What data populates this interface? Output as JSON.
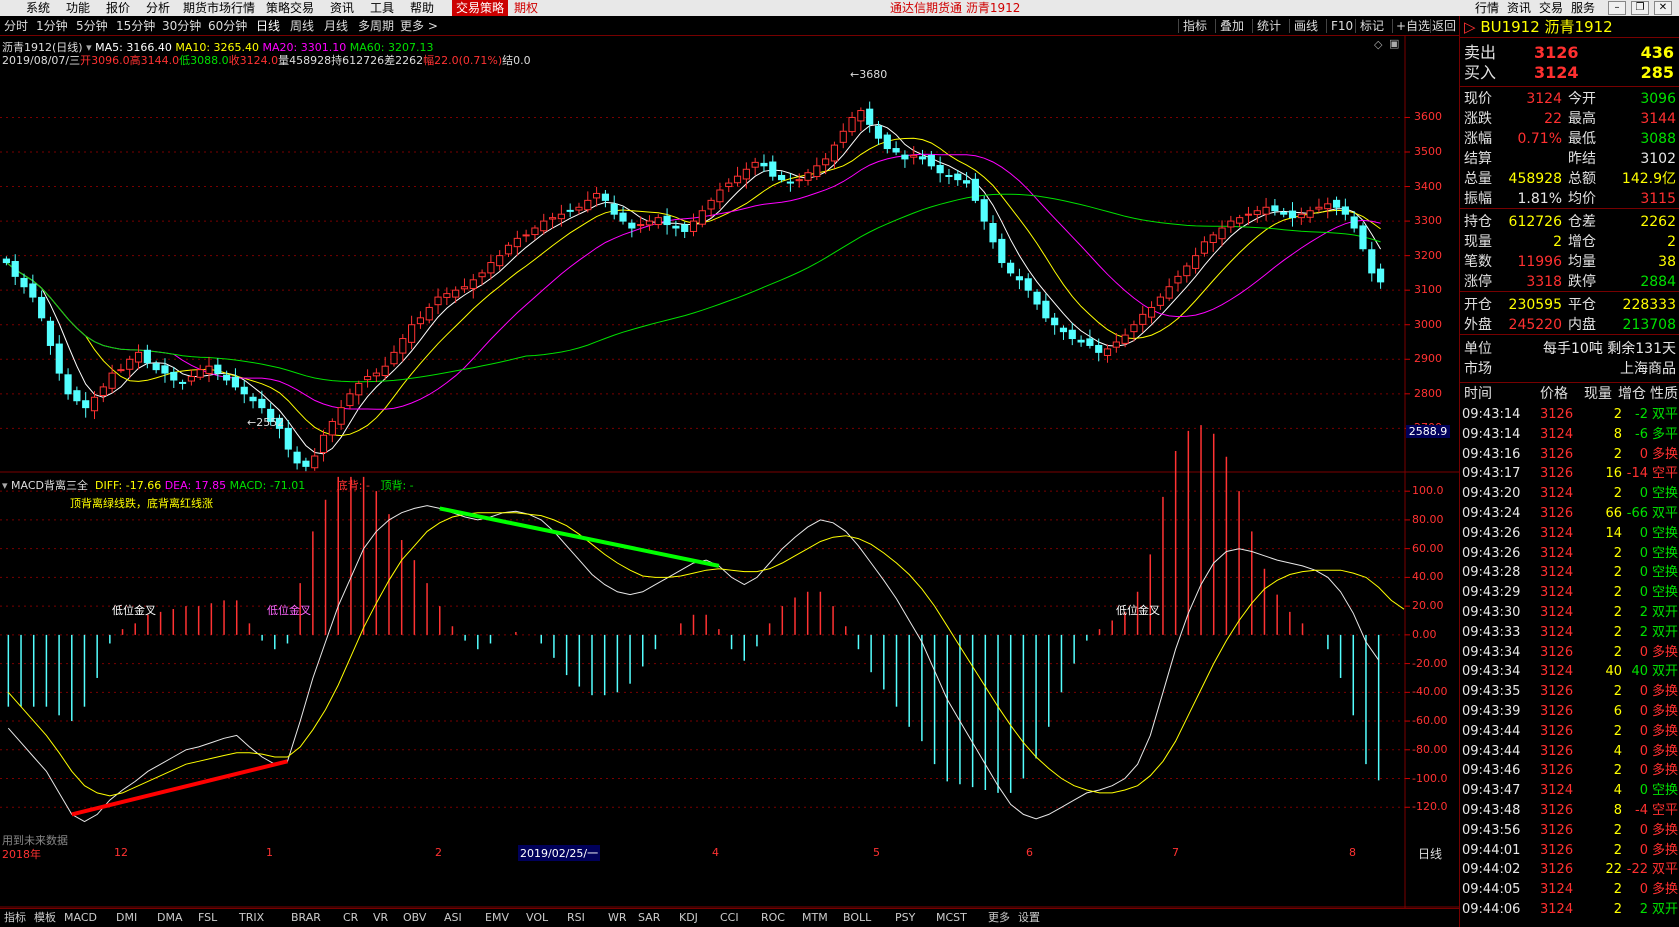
{
  "menu": {
    "items": [
      "系统",
      "功能",
      "报价",
      "分析",
      "期货市场行情",
      "策略交易",
      "资讯",
      "工具",
      "帮助"
    ],
    "hot_items": [
      "交易策略",
      "期权"
    ],
    "window_title": "通达信期货通  沥青1912",
    "right_items": [
      "行情",
      "资讯",
      "交易",
      "服务"
    ]
  },
  "toolbar": {
    "periods": [
      "分时",
      "1分钟",
      "5分钟",
      "15分钟",
      "30分钟",
      "60分钟",
      "日线",
      "周线",
      "月线",
      "多周期",
      "更多 >"
    ],
    "selected": "日线",
    "right_buttons": [
      "指标",
      "叠加",
      "统计",
      "画线",
      "F10",
      "标记",
      "+自选",
      "返回"
    ]
  },
  "kline": {
    "title": "沥青1912(日线)",
    "ma5_label": "MA5: 3166.40",
    "ma10_label": "MA10: 3265.40",
    "ma20_label": "MA20: 3301.10",
    "ma60_label": "MA60: 3207.13",
    "info_date": "2019/08/07/三",
    "info_open": "开3096.0",
    "info_high": "高3144.0",
    "info_low": "低3088.0",
    "info_close": "收3124.0",
    "info_vol": "量458928",
    "info_oi": "持612726",
    "info_diff": "差2262",
    "info_chg": "幅22.0(0.71%)",
    "info_settle": "结0.0",
    "high_mark": "3680",
    "low_mark": "2552",
    "cursor_value": "2588.9",
    "price_ticks": [
      "3600",
      "3500",
      "3400",
      "3300",
      "3200",
      "3100",
      "3000",
      "2900",
      "2800",
      "2700"
    ]
  },
  "macd": {
    "title": "MACD背离三全",
    "diff_label": "DIFF: -17.66",
    "dea_label": "DEA: 17.85",
    "macd_label": "MACD: -71.01",
    "bottom_div": "底背: -",
    "top_div": "顶背: -",
    "note": "顶背离绿线跌，底背离红线涨",
    "cross_labels": [
      "低位金叉",
      "低位金叉",
      "低位金叉"
    ],
    "ticks": [
      "100.0",
      "80.00",
      "60.00",
      "40.00",
      "20.00",
      "0.00",
      "-20.00",
      "-40.00",
      "-60.00",
      "-80.00",
      "-100.0",
      "-120.0"
    ],
    "future_note": "用到未来数据"
  },
  "xaxis": {
    "labels": [
      "2018年",
      "12",
      "1",
      "2",
      "2019/02/25/一",
      "4",
      "5",
      "6",
      "7",
      "8"
    ],
    "right_label": "日线"
  },
  "status_tabs": [
    "指标",
    "模板",
    "MACD",
    "DMI",
    "DMA",
    "FSL",
    "TRIX",
    "BRAR",
    "CR",
    "VR",
    "OBV",
    "ASI",
    "EMV",
    "VOL",
    "RSI",
    "WR",
    "SAR",
    "KDJ",
    "CCI",
    "ROC",
    "MTM",
    "BOLL",
    "PSY",
    "MCST",
    "更多",
    "设置"
  ],
  "quote": {
    "contract": "BU1912 沥青1912",
    "sell_label": "卖出",
    "sell_price": "3126",
    "sell_vol": "436",
    "buy_label": "买入",
    "buy_price": "3124",
    "buy_vol": "285",
    "rows": [
      {
        "l1": "现价",
        "v1": "3124",
        "c1": "red",
        "l2": "今开",
        "v2": "3096",
        "c2": "grn"
      },
      {
        "l1": "涨跌",
        "v1": "22",
        "c1": "red",
        "l2": "最高",
        "v2": "3144",
        "c2": "red"
      },
      {
        "l1": "涨幅",
        "v1": "0.71%",
        "c1": "red",
        "l2": "最低",
        "v2": "3088",
        "c2": "grn"
      },
      {
        "l1": "结算",
        "v1": "",
        "c1": "wht",
        "l2": "昨结",
        "v2": "3102",
        "c2": "wht"
      },
      {
        "l1": "总量",
        "v1": "458928",
        "c1": "yel",
        "l2": "总额",
        "v2": "142.9亿",
        "c2": "yel"
      },
      {
        "l1": "振幅",
        "v1": "1.81%",
        "c1": "wht",
        "l2": "均价",
        "v2": "3115",
        "c2": "red"
      }
    ],
    "rows2": [
      {
        "l1": "持仓",
        "v1": "612726",
        "c1": "yel",
        "l2": "仓差",
        "v2": "2262",
        "c2": "yel"
      },
      {
        "l1": "现量",
        "v1": "2",
        "c1": "yel",
        "l2": "增仓",
        "v2": "2",
        "c2": "yel"
      },
      {
        "l1": "笔数",
        "v1": "11996",
        "c1": "red",
        "l2": "均量",
        "v2": "38",
        "c2": "yel"
      },
      {
        "l1": "涨停",
        "v1": "3318",
        "c1": "red",
        "l2": "跌停",
        "v2": "2884",
        "c2": "grn"
      }
    ],
    "rows3": [
      {
        "l1": "开仓",
        "v1": "230595",
        "c1": "yel",
        "l2": "平仓",
        "v2": "228333",
        "c2": "yel"
      },
      {
        "l1": "外盘",
        "v1": "245220",
        "c1": "red",
        "l2": "内盘",
        "v2": "213708",
        "c2": "grn"
      }
    ],
    "unit_label": "单位",
    "unit_value": "每手10吨  剩余131天",
    "market_label": "市场",
    "market_value": "上海商品",
    "tick_headers": [
      "时间",
      "价格",
      "现量",
      "增仓",
      "性质"
    ]
  },
  "ticks": [
    [
      "09:43:14",
      "3126",
      "2",
      "-2",
      "双平",
      "red",
      "grn"
    ],
    [
      "09:43:14",
      "3124",
      "8",
      "-6",
      "多平",
      "red",
      "grn"
    ],
    [
      "09:43:16",
      "3126",
      "2",
      "0",
      "多换",
      "red",
      "red"
    ],
    [
      "09:43:17",
      "3126",
      "16",
      "-14",
      "空平",
      "red",
      "red"
    ],
    [
      "09:43:20",
      "3124",
      "2",
      "0",
      "空换",
      "red",
      "grn"
    ],
    [
      "09:43:24",
      "3126",
      "66",
      "-66",
      "双平",
      "red",
      "grn"
    ],
    [
      "09:43:26",
      "3124",
      "14",
      "0",
      "空换",
      "red",
      "grn"
    ],
    [
      "09:43:26",
      "3124",
      "2",
      "0",
      "空换",
      "red",
      "grn"
    ],
    [
      "09:43:28",
      "3124",
      "2",
      "0",
      "空换",
      "red",
      "grn"
    ],
    [
      "09:43:29",
      "3124",
      "2",
      "0",
      "空换",
      "red",
      "grn"
    ],
    [
      "09:43:30",
      "3124",
      "2",
      "2",
      "双开",
      "red",
      "grn"
    ],
    [
      "09:43:33",
      "3124",
      "2",
      "2",
      "双开",
      "red",
      "grn"
    ],
    [
      "09:43:34",
      "3126",
      "2",
      "0",
      "多换",
      "red",
      "red"
    ],
    [
      "09:43:34",
      "3124",
      "40",
      "40",
      "双开",
      "red",
      "grn"
    ],
    [
      "09:43:35",
      "3126",
      "2",
      "0",
      "多换",
      "red",
      "red"
    ],
    [
      "09:43:39",
      "3126",
      "6",
      "0",
      "多换",
      "red",
      "red"
    ],
    [
      "09:43:44",
      "3126",
      "2",
      "0",
      "多换",
      "red",
      "red"
    ],
    [
      "09:43:44",
      "3126",
      "4",
      "0",
      "多换",
      "red",
      "red"
    ],
    [
      "09:43:46",
      "3126",
      "2",
      "0",
      "多换",
      "red",
      "red"
    ],
    [
      "09:43:47",
      "3124",
      "4",
      "0",
      "空换",
      "red",
      "grn"
    ],
    [
      "09:43:48",
      "3126",
      "8",
      "-4",
      "空平",
      "red",
      "red"
    ],
    [
      "09:43:56",
      "3126",
      "2",
      "0",
      "多换",
      "red",
      "red"
    ],
    [
      "09:44:01",
      "3126",
      "2",
      "0",
      "多换",
      "red",
      "red"
    ],
    [
      "09:44:02",
      "3126",
      "22",
      "-22",
      "双平",
      "red",
      "red"
    ],
    [
      "09:44:05",
      "3124",
      "2",
      "0",
      "多换",
      "red",
      "red"
    ],
    [
      "09:44:06",
      "3124",
      "2",
      "2",
      "双开",
      "red",
      "grn"
    ]
  ],
  "colors": {
    "up": "#ff3232",
    "down": "#54ffff",
    "ma5": "#ffffff",
    "ma10": "#ffff00",
    "ma20": "#ff00ff",
    "ma60": "#00e000",
    "grid": "#7a0000",
    "top_div_line": "#00ff00",
    "bottom_div_line": "#ff0000"
  },
  "chart_data": {
    "type": "line",
    "title": "",
    "price_axis": {
      "ylim": [
        2620,
        3720
      ]
    },
    "closes": [
      3180,
      3140,
      3110,
      3080,
      3020,
      2940,
      2860,
      2800,
      2780,
      2760,
      2790,
      2820,
      2860,
      2870,
      2900,
      2920,
      2890,
      2870,
      2860,
      2840,
      2830,
      2850,
      2870,
      2880,
      2860,
      2840,
      2820,
      2800,
      2780,
      2760,
      2720,
      2700,
      2640,
      2600,
      2590,
      2620,
      2680,
      2720,
      2760,
      2800,
      2830,
      2850,
      2860,
      2880,
      2920,
      2960,
      3000,
      3020,
      3050,
      3080,
      3090,
      3100,
      3110,
      3130,
      3150,
      3180,
      3200,
      3230,
      3250,
      3260,
      3280,
      3300,
      3310,
      3320,
      3330,
      3340,
      3360,
      3380,
      3360,
      3320,
      3300,
      3280,
      3290,
      3300,
      3310,
      3290,
      3280,
      3270,
      3300,
      3330,
      3360,
      3390,
      3410,
      3430,
      3450,
      3470,
      3460,
      3430,
      3420,
      3410,
      3420,
      3440,
      3460,
      3480,
      3520,
      3560,
      3600,
      3620,
      3580,
      3540,
      3510,
      3500,
      3480,
      3490,
      3480,
      3460,
      3440,
      3430,
      3420,
      3410,
      3360,
      3300,
      3240,
      3180,
      3150,
      3130,
      3100,
      3060,
      3020,
      3000,
      2980,
      2960,
      2950,
      2940,
      2920,
      2930,
      2950,
      2970,
      3000,
      3030,
      3050,
      3080,
      3110,
      3140,
      3170,
      3200,
      3240,
      3260,
      3280,
      3300,
      3310,
      3320,
      3330,
      3340,
      3330,
      3320,
      3310,
      3320,
      3330,
      3340,
      3350,
      3340,
      3320,
      3280,
      3220,
      3150,
      3124
    ],
    "macd_axis": {
      "ylim": [
        -140,
        105
      ]
    },
    "diff": [
      -65,
      -75,
      -85,
      -95,
      -110,
      -125,
      -130,
      -125,
      -115,
      -108,
      -102,
      -95,
      -90,
      -85,
      -80,
      -78,
      -75,
      -72,
      -70,
      -78,
      -85,
      -90,
      -88,
      -60,
      -30,
      -5,
      20,
      40,
      60,
      72,
      80,
      85,
      88,
      90,
      88,
      85,
      82,
      80,
      82,
      85,
      86,
      84,
      80,
      72,
      62,
      52,
      42,
      35,
      30,
      28,
      30,
      35,
      40,
      45,
      50,
      52,
      48,
      40,
      35,
      40,
      50,
      60,
      68,
      75,
      80,
      78,
      72,
      62,
      50,
      38,
      25,
      10,
      -5,
      -25,
      -45,
      -60,
      -75,
      -90,
      -105,
      -118,
      -125,
      -128,
      -125,
      -120,
      -115,
      -110,
      -108,
      -105,
      -100,
      -90,
      -70,
      -40,
      -10,
      15,
      35,
      50,
      58,
      60,
      58,
      55,
      52,
      50,
      48,
      45,
      40,
      30,
      15,
      -5,
      -17.66
    ],
    "dea": [
      -40,
      -50,
      -60,
      -70,
      -82,
      -95,
      -105,
      -110,
      -112,
      -110,
      -106,
      -102,
      -98,
      -94,
      -90,
      -88,
      -86,
      -84,
      -82,
      -82,
      -83,
      -85,
      -85,
      -78,
      -66,
      -52,
      -35,
      -15,
      5,
      22,
      38,
      52,
      62,
      72,
      78,
      82,
      84,
      85,
      85,
      85,
      85,
      84,
      83,
      80,
      76,
      70,
      63,
      56,
      50,
      45,
      41,
      40,
      40,
      41,
      43,
      45,
      46,
      45,
      44,
      44,
      46,
      50,
      55,
      60,
      65,
      68,
      69,
      67,
      63,
      57,
      50,
      42,
      32,
      20,
      6,
      -8,
      -22,
      -36,
      -50,
      -63,
      -75,
      -85,
      -93,
      -100,
      -105,
      -108,
      -110,
      -110,
      -108,
      -105,
      -98,
      -88,
      -74,
      -56,
      -38,
      -20,
      -4,
      10,
      22,
      32,
      38,
      42,
      44,
      45,
      45,
      45,
      43,
      40,
      33,
      24,
      17.85
    ]
  }
}
